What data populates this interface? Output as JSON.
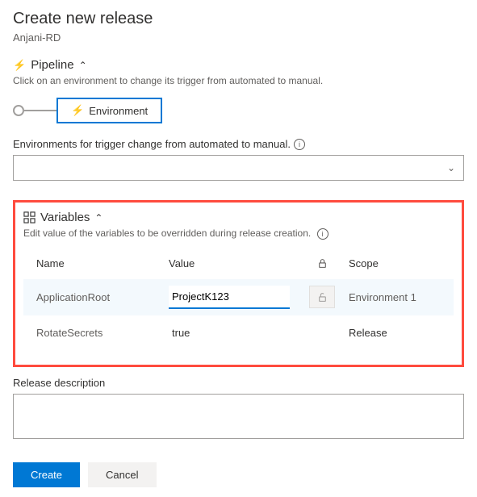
{
  "header": {
    "title": "Create new release",
    "subtitle": "Anjani-RD"
  },
  "pipeline": {
    "section_label": "Pipeline",
    "desc": "Click on an environment to change its trigger from automated to manual.",
    "env_box_label": "Environment"
  },
  "env_trigger": {
    "label": "Environments for trigger change from automated to manual."
  },
  "variables": {
    "section_label": "Variables",
    "desc": "Edit value of the variables to be overridden during release creation.",
    "headers": {
      "name": "Name",
      "value": "Value",
      "scope": "Scope"
    },
    "rows": [
      {
        "name": "ApplicationRoot",
        "value": "ProjectK123",
        "scope": "Environment 1"
      },
      {
        "name": "RotateSecrets",
        "value": "true",
        "scope": "Release"
      }
    ]
  },
  "release_description": {
    "label": "Release description",
    "value": ""
  },
  "actions": {
    "create": "Create",
    "cancel": "Cancel"
  }
}
